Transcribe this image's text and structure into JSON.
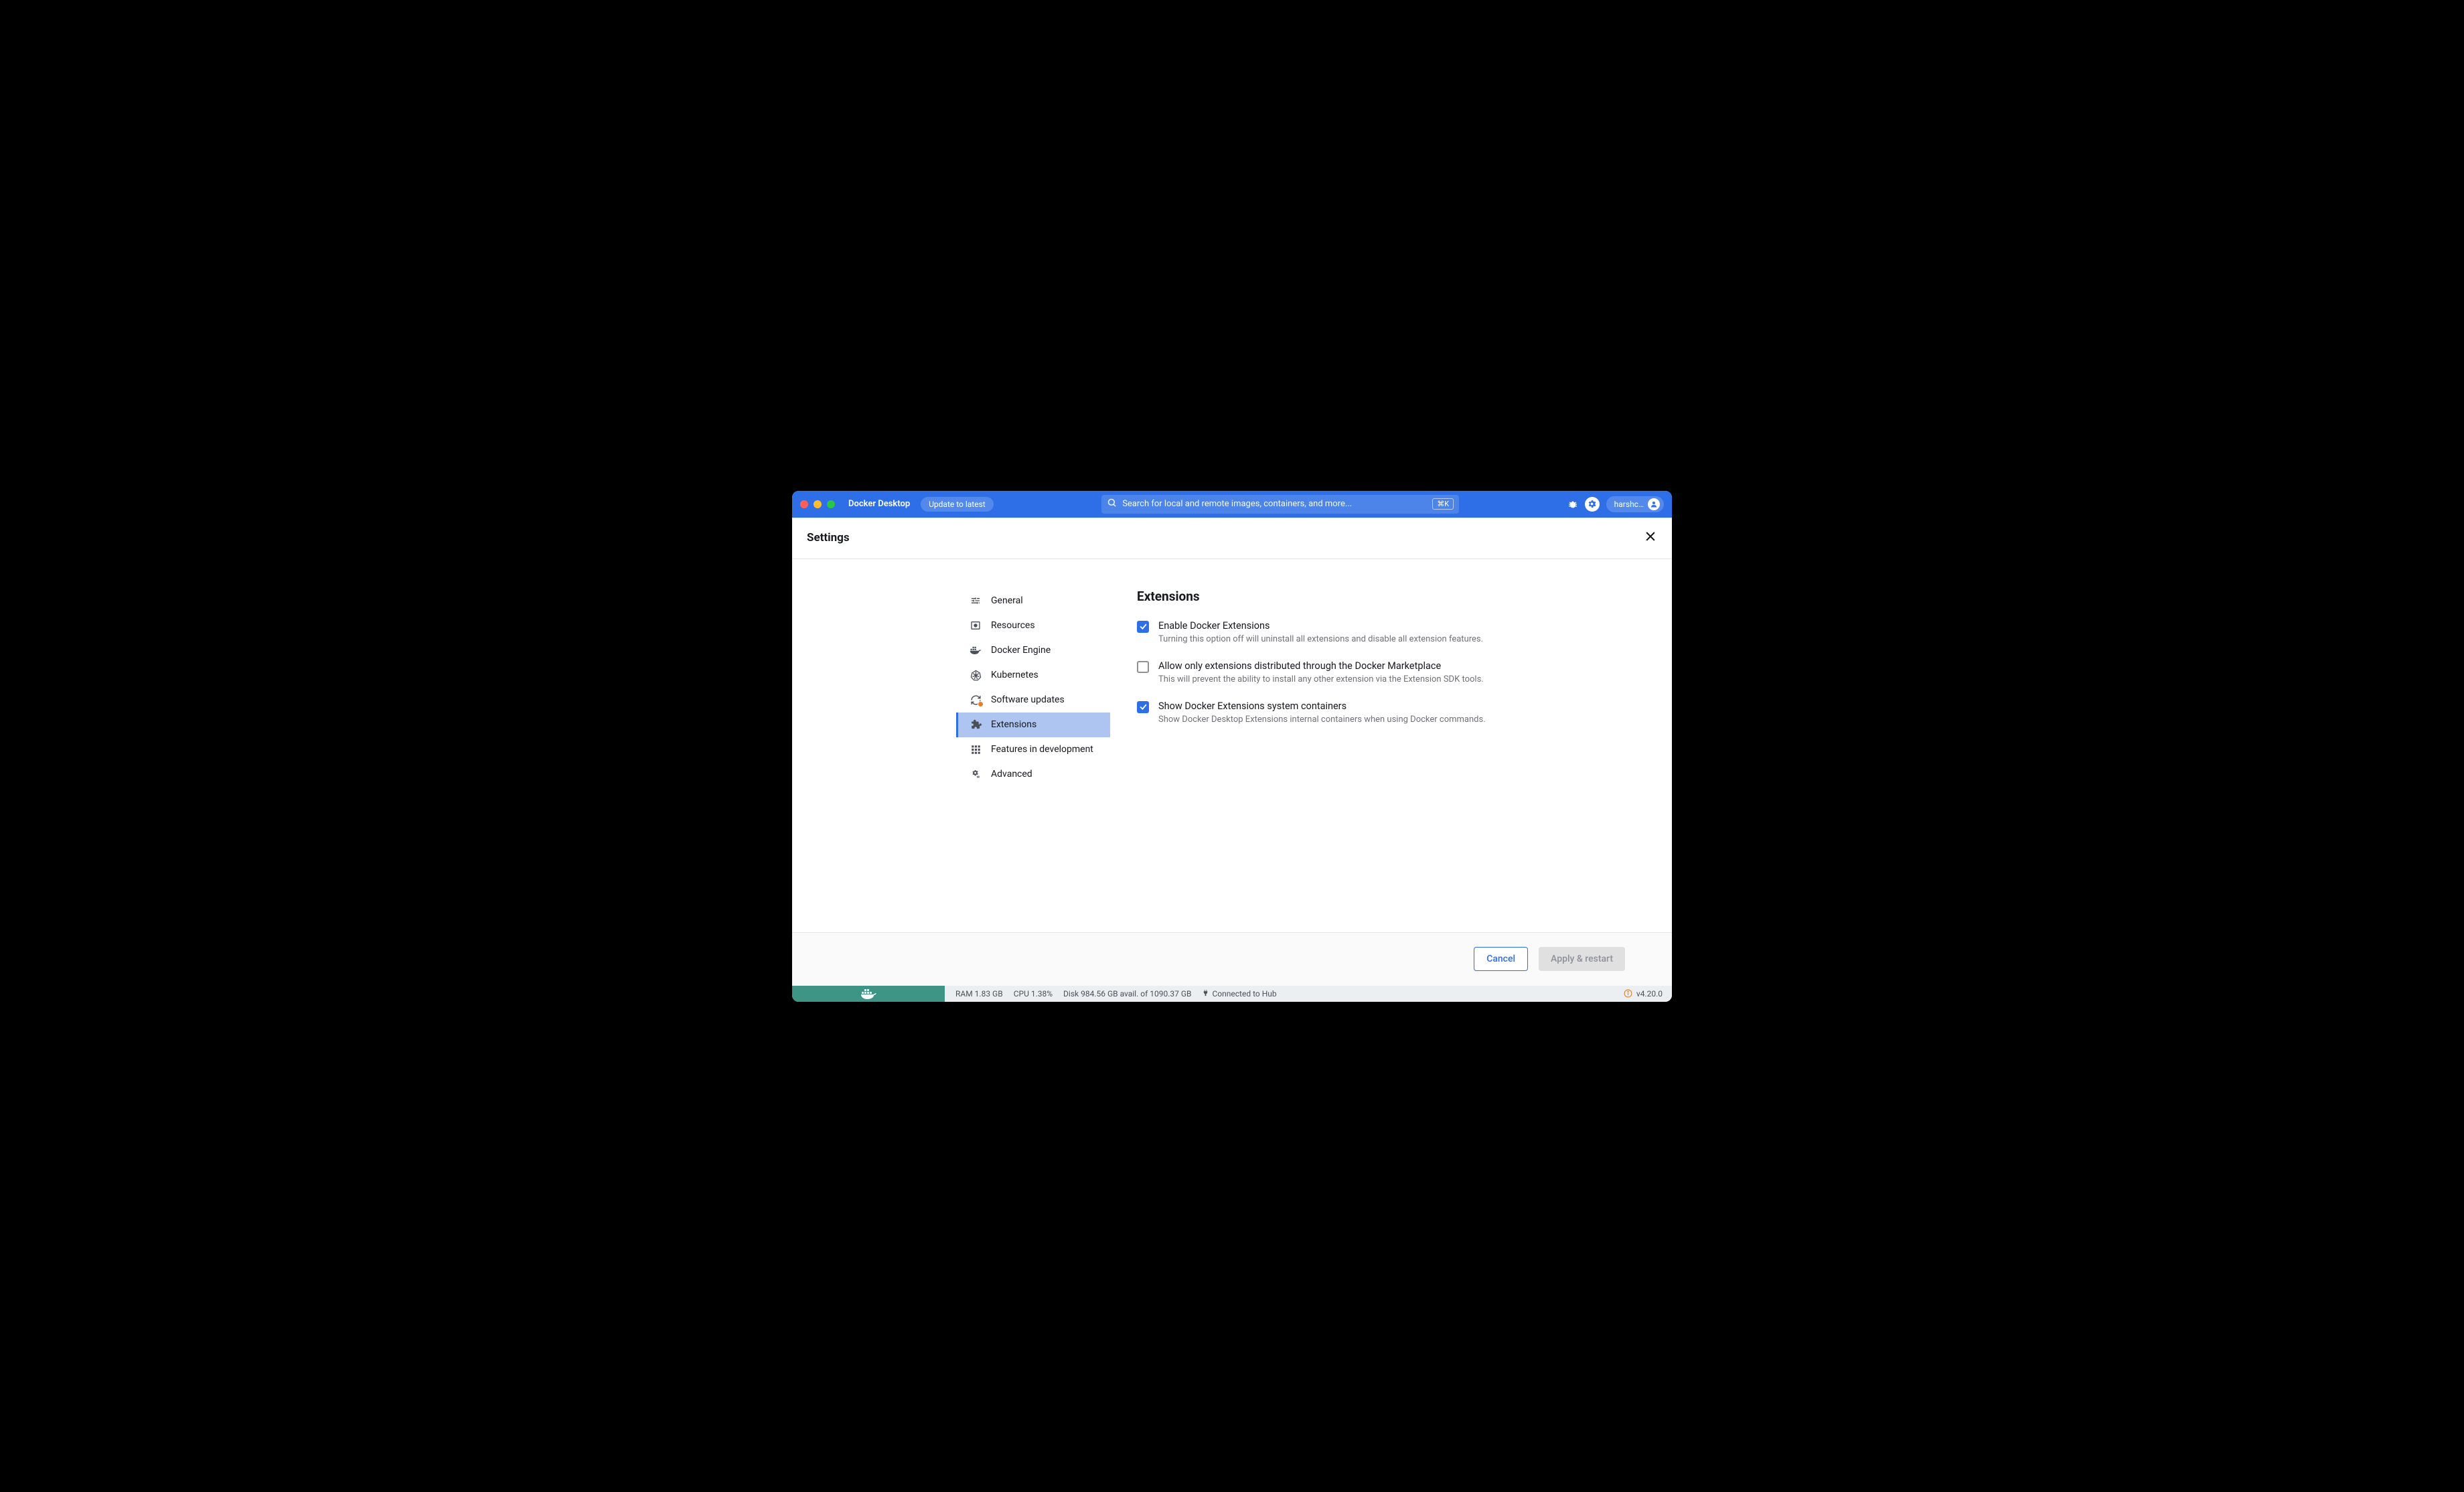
{
  "header": {
    "app_title": "Docker Desktop",
    "update_label": "Update to latest",
    "search_placeholder": "Search for local and remote images, containers, and more...",
    "kbd": "⌘K",
    "username": "harshc…"
  },
  "settings": {
    "title": "Settings"
  },
  "sidebar": {
    "items": [
      {
        "label": "General"
      },
      {
        "label": "Resources"
      },
      {
        "label": "Docker Engine"
      },
      {
        "label": "Kubernetes"
      },
      {
        "label": "Software updates"
      },
      {
        "label": "Extensions"
      },
      {
        "label": "Features in development"
      },
      {
        "label": "Advanced"
      }
    ]
  },
  "main": {
    "title": "Extensions",
    "options": [
      {
        "label": "Enable Docker Extensions",
        "desc": "Turning this option off will uninstall all extensions and disable all extension features.",
        "checked": true
      },
      {
        "label": "Allow only extensions distributed through the Docker Marketplace",
        "desc": "This will prevent the ability to install any other extension via the Extension SDK tools.",
        "checked": false
      },
      {
        "label": "Show Docker Extensions system containers",
        "desc": "Show Docker Desktop Extensions internal containers when using Docker commands.",
        "checked": true
      }
    ]
  },
  "actions": {
    "cancel": "Cancel",
    "apply": "Apply & restart"
  },
  "status": {
    "ram": "RAM 1.83 GB",
    "cpu": "CPU 1.38%",
    "disk": "Disk 984.56 GB avail. of 1090.37 GB",
    "hub": "Connected to Hub",
    "version": "v4.20.0"
  }
}
